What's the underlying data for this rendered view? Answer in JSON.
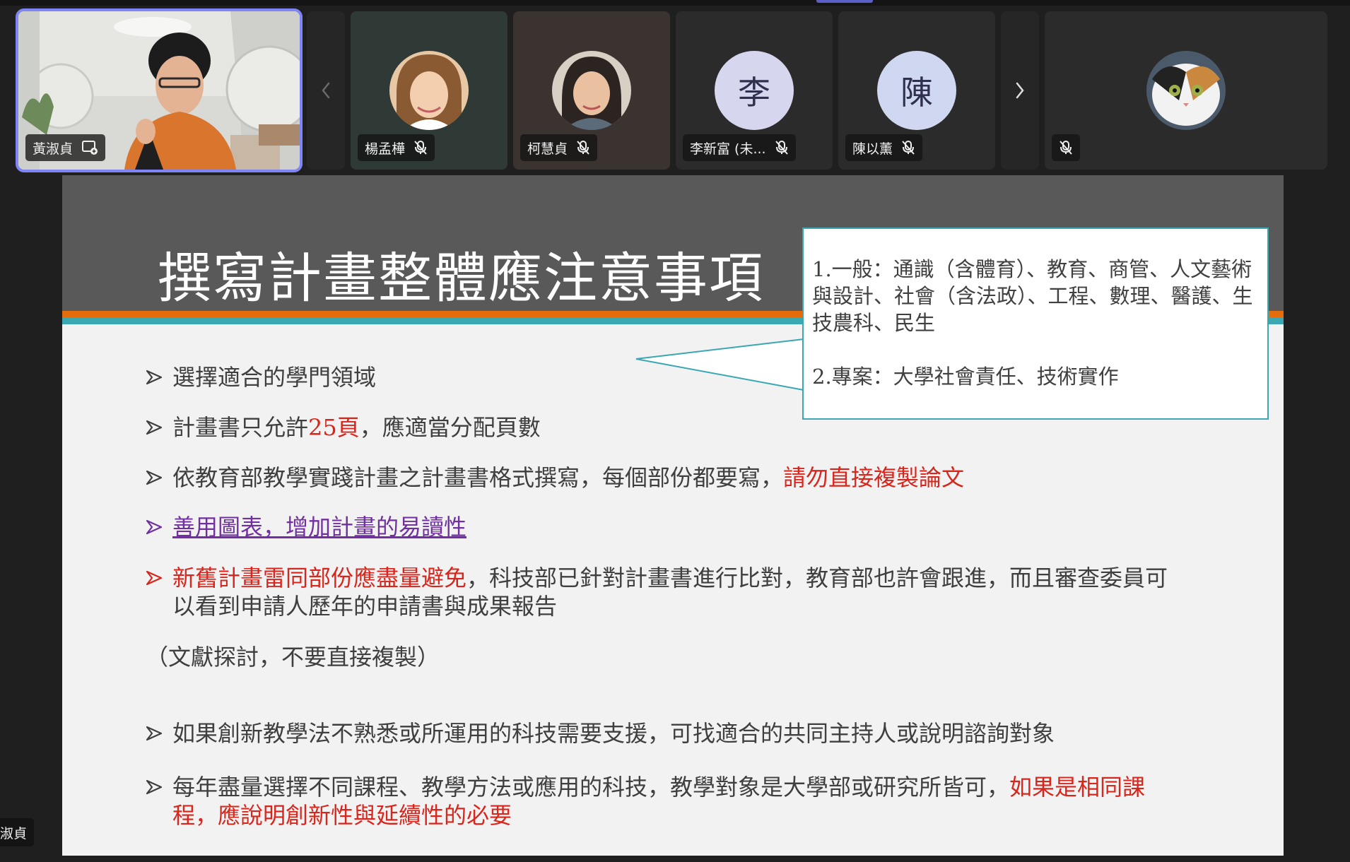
{
  "participants": [
    {
      "name": "黃淑貞",
      "type": "video",
      "active": true
    },
    {
      "name": "楊孟樺",
      "type": "photo",
      "muted": true
    },
    {
      "name": "柯慧貞",
      "type": "photo",
      "muted": true
    },
    {
      "name": "李新富 (未...",
      "type": "initial",
      "initial": "李",
      "color": "#d6d6ee",
      "muted": true
    },
    {
      "name": "陳以薰",
      "type": "initial",
      "initial": "陳",
      "color": "#cfd8f0",
      "muted": true
    },
    {
      "name": "",
      "type": "photo",
      "muted": true
    }
  ],
  "nav": {
    "prev_icon": "chevron-left-icon",
    "next_icon": "chevron-right-icon"
  },
  "slide": {
    "title": "撰寫計畫整體應注意事項",
    "callout": {
      "line1": "1.一般：通識（含體育）、教育、商管、人文藝術與設計、社會（含法政）、工程、數理、醫護、生技農科、民生",
      "line2": "2.專案：大學社會責任、技術實作"
    },
    "bullets": {
      "b1": "選擇適合的學門領域",
      "b2_a": "計畫書只允許",
      "b2_b": "25頁",
      "b2_c": "，應適當分配頁數",
      "b3_a": "依教育部教學實踐計畫之計畫書格式撰寫，每個部份都要寫，",
      "b3_b": "請勿直接複製論文",
      "b4": "善用圖表，增加計畫的易讀性",
      "b5_a": "新舊計畫雷同部份應盡量避免",
      "b5_b": "，科技部已針對計畫書進行比對，教育部也許會跟進，而且審查委員可以看到申請人歷年的申請書與成果報告",
      "b6": "（文獻探討，不要直接複製）",
      "b7": "如果創新教學法不熟悉或所運用的科技需要支援，可找適合的共同主持人或說明諮詢對象",
      "b8_a": "每年盡量選擇不同課程、教學方法或應用的科技，教學對象是大學部或研究所皆可，",
      "b8_b": "如果是相同課程，應說明創新性與延續性的必要"
    }
  },
  "presenter_tag": "淑貞",
  "colors": {
    "accent": "#7f85f5",
    "slide_header": "#595959",
    "orange": "#e46c0a",
    "teal": "#3aa7b3",
    "red": "#d9261c",
    "purple": "#7030a0"
  }
}
